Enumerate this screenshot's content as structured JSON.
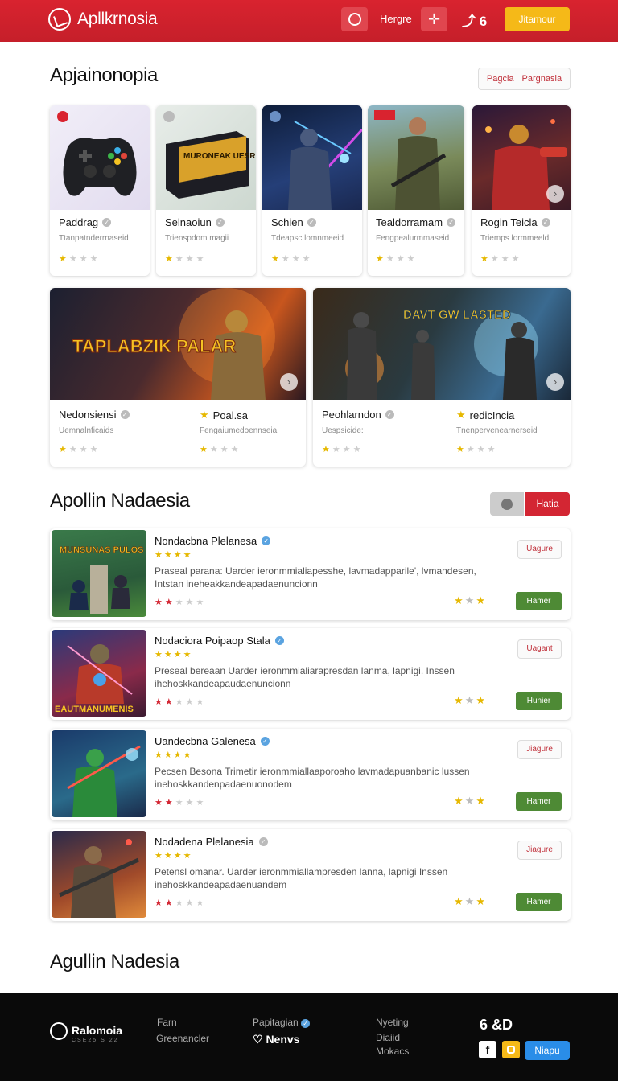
{
  "header": {
    "brand": "Apllkrnosia",
    "text_link": "Hergre",
    "share_count": "6",
    "cta_label": "Jitamour"
  },
  "section1": {
    "title": "Apjainonopia",
    "pill_a": "Pagcia",
    "pill_b": "Pargnasia",
    "cards": [
      {
        "title": "Paddrag",
        "sub": "Ttanpatnderrnaseid",
        "rating": 1
      },
      {
        "title": "Selnaoiun",
        "sub": "Trienspdom magii",
        "rating": 1
      },
      {
        "title": "Schien",
        "sub": "Tdeapsc lomnmeeid",
        "rating": 1
      },
      {
        "title": "Tealdorramam",
        "sub": "Fengpealurmmaseid",
        "rating": 1
      },
      {
        "title": "Rogin Teicla",
        "sub": "Triemps lormmeeld",
        "rating": 1
      }
    ],
    "box_art_text": "MURONEAK UESRIES"
  },
  "featured": [
    {
      "art_text": "TAPLABZIK PALAR",
      "left_title": "Nedonsiensi",
      "left_sub": "Uemnalnficaids",
      "right_title": "Poal.sa",
      "right_sub": "Fengaiumedoennseia"
    },
    {
      "art_text": "DAVT GW LASTED",
      "left_title": "Peohlarndon",
      "left_sub": "Uespsicide:",
      "right_title": "redicIncia",
      "right_sub": "Tnenpervenearnerseid"
    }
  ],
  "section2": {
    "title": "Apollin Nadaesia",
    "toggle_label": "Hatia",
    "items": [
      {
        "title": "Nondacbna Plelanesa",
        "verified": "blue",
        "desc": "Praseal parana: Uarder ieronmmialiapesshe, lavmadapparile', lvmandesen, Intstan ineheakkandeapadaenuncionn",
        "btn_top": "Uagure",
        "btn_green": "Hamer",
        "thumb_text": "MUNSUNAS PULOS"
      },
      {
        "title": "Nodaciora Poipaop Stala",
        "verified": "blue",
        "desc": "Preseal bereaan Uarder ieronmmialiarapresdan lanma, lapnigi. Inssen ihehoskkandeapaudaenuncionn",
        "btn_top": "Uagant",
        "btn_green": "Hunier",
        "thumb_text": "EAUTMANUMENIS"
      },
      {
        "title": "Uandecbna Galenesa",
        "verified": "blue",
        "desc": "Pecsen Besona Trimetir ieronmmiallaaporoaho lavmadapuanbanic lussen inehoskkandenpadaenuonodem",
        "btn_top": "Jiagure",
        "btn_green": "Hamer",
        "thumb_text": ""
      },
      {
        "title": "Nodadena Plelanesia",
        "verified": "grey",
        "desc": "Petensl omanar. Uarder ieronmmiallampresden lanna, lapnigi Inssen inehoskkandeapadaenuandem",
        "btn_top": "Jiagure",
        "btn_green": "Hamer",
        "thumb_text": ""
      }
    ]
  },
  "section3": {
    "title": "Agullin Nadesia"
  },
  "footer": {
    "brand": "Ralomoia",
    "brand_sub": "CSE25 S 22",
    "col1": [
      "Farn",
      "Greenancler"
    ],
    "col2_top": "Papitagian",
    "col2_big": "♡ Nenvs",
    "col3": [
      "Nyeting",
      "Diaiid",
      "Mokacs"
    ],
    "col4_big": "6 &D",
    "cta": "Niapu"
  },
  "colors": {
    "brand_red": "#d9232f",
    "cta_yellow": "#f5b918",
    "green_button": "#4e8a35",
    "footer_bg": "#0a0a0a",
    "footer_cta": "#2a8de8"
  }
}
